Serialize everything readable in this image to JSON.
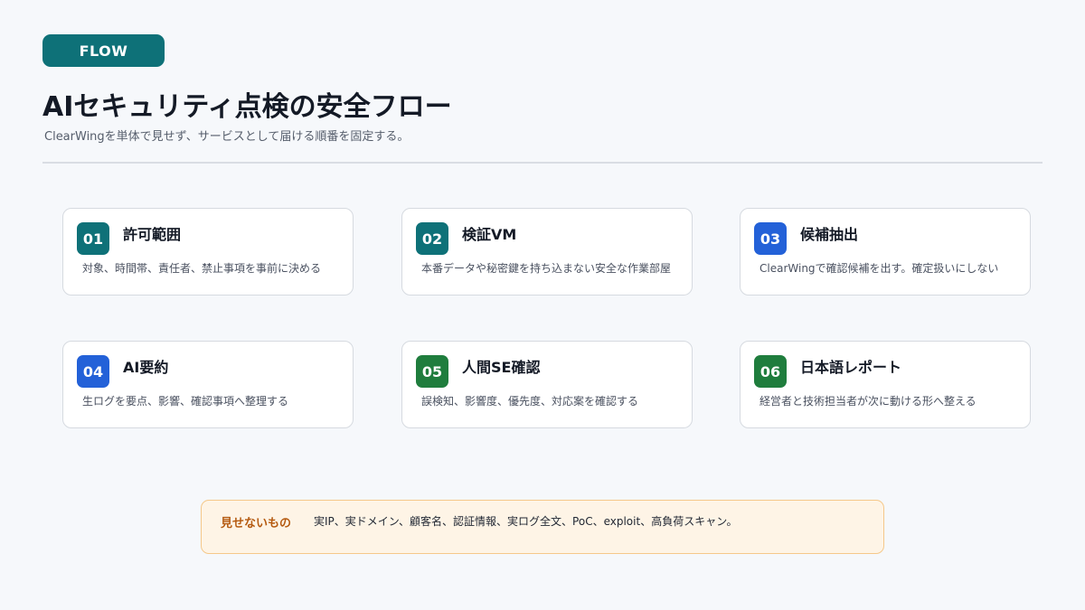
{
  "badge": {
    "label": "FLOW"
  },
  "header": {
    "title": "AIセキュリティ点検の安全フロー",
    "subtitle": "ClearWingを単体で見せず、サービスとして届ける順番を固定する。"
  },
  "colors": {
    "teal": "#0e7178",
    "blue": "#2361d8",
    "green": "#1f7d3d",
    "note_bg": "#fef4e6",
    "note_label": "#b55a10"
  },
  "steps": [
    {
      "num": "01",
      "title": "許可範囲",
      "desc": "対象、時間帯、責任者、禁止事項を事前に決める",
      "color": "teal"
    },
    {
      "num": "02",
      "title": "検証VM",
      "desc": "本番データや秘密鍵を持ち込まない安全な作業部屋",
      "color": "teal"
    },
    {
      "num": "03",
      "title": "候補抽出",
      "desc": "ClearWingで確認候補を出す。確定扱いにしない",
      "color": "blue"
    },
    {
      "num": "04",
      "title": "AI要約",
      "desc": "生ログを要点、影響、確認事項へ整理する",
      "color": "blue"
    },
    {
      "num": "05",
      "title": "人間SE確認",
      "desc": "誤検知、影響度、優先度、対応案を確認する",
      "color": "green"
    },
    {
      "num": "06",
      "title": "日本語レポート",
      "desc": "経営者と技術担当者が次に動ける形へ整える",
      "color": "green"
    }
  ],
  "note": {
    "label": "見せないもの",
    "text": "実IP、実ドメイン、顧客名、認証情報、実ログ全文、PoC、exploit、高負荷スキャン。"
  }
}
